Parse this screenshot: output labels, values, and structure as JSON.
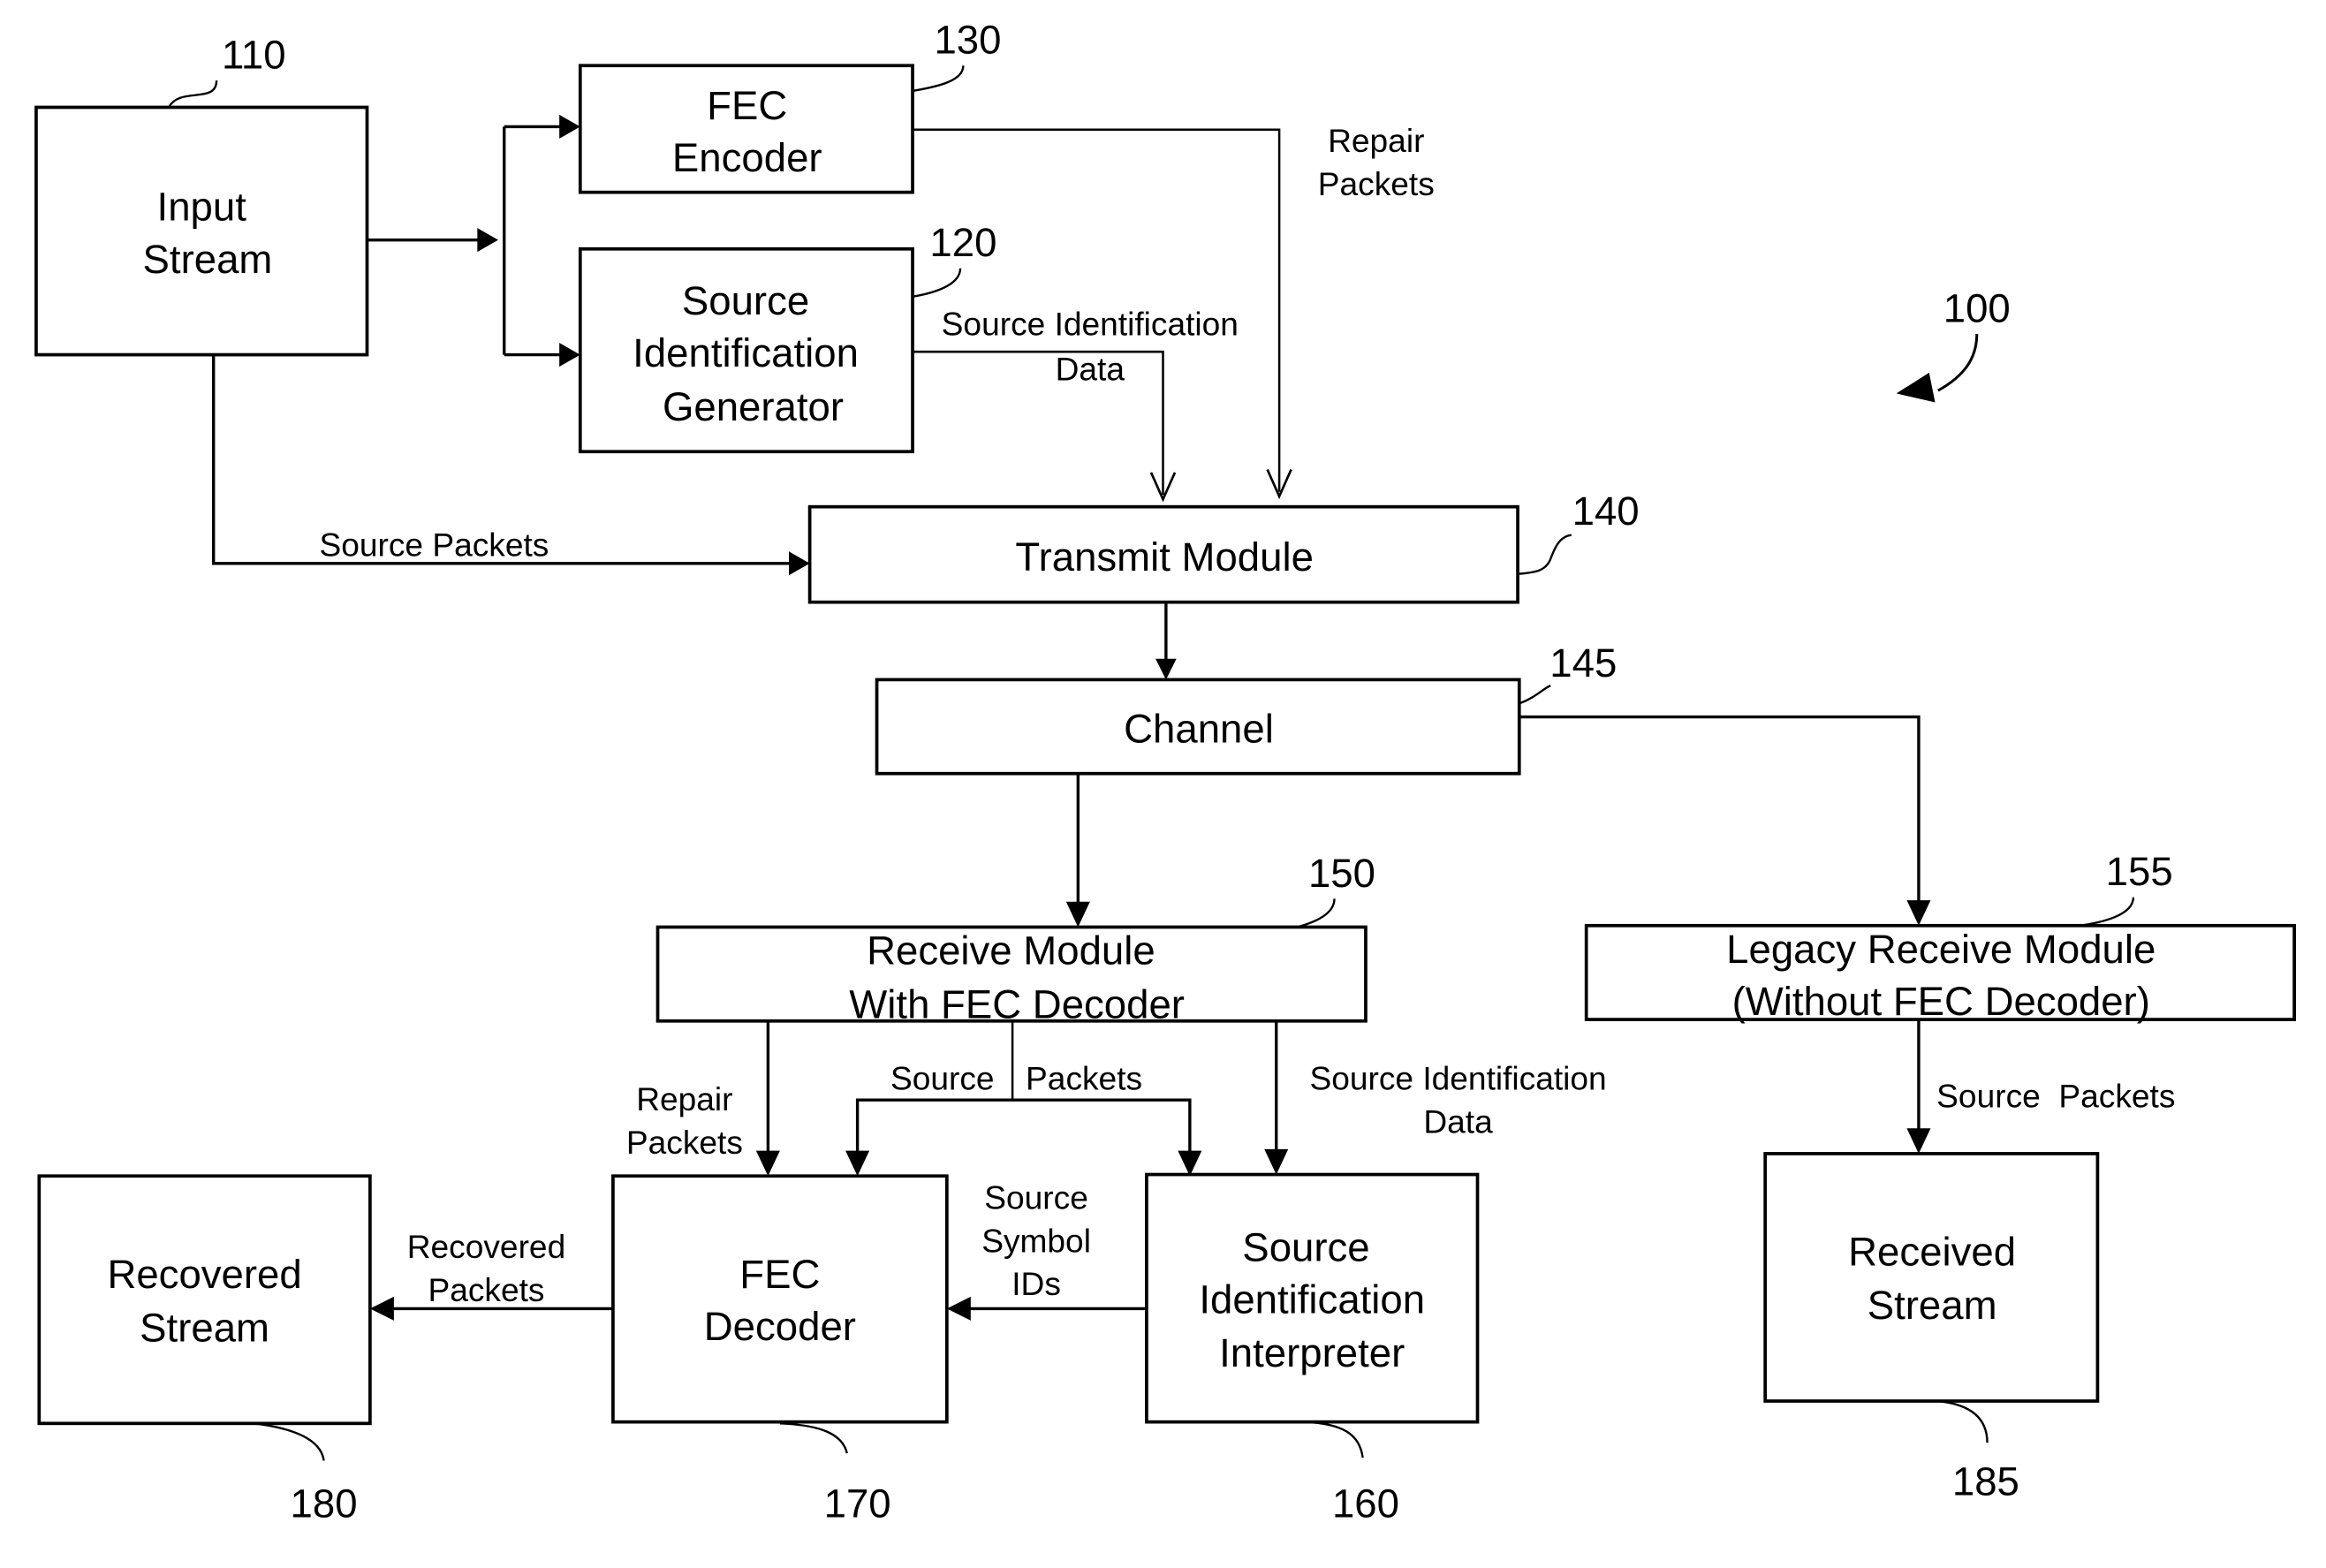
{
  "figure": {
    "reference": "100",
    "blocks": {
      "input_stream": {
        "ref": "110",
        "lines": [
          "Input",
          "Stream"
        ]
      },
      "fec_encoder": {
        "ref": "130",
        "lines": [
          "FEC",
          "Encoder"
        ]
      },
      "source_id_generator": {
        "ref": "120",
        "lines": [
          "Source",
          "Identification",
          "Generator"
        ]
      },
      "transmit_module": {
        "ref": "140",
        "lines": [
          "Transmit Module"
        ]
      },
      "channel": {
        "ref": "145",
        "lines": [
          "Channel"
        ]
      },
      "receive_module": {
        "ref": "150",
        "lines": [
          "Receive Module",
          "With FEC Decoder"
        ]
      },
      "legacy_receive_module": {
        "ref": "155",
        "lines": [
          "Legacy Receive Module",
          "(Without FEC Decoder)"
        ]
      },
      "source_id_interpreter": {
        "ref": "160",
        "lines": [
          "Source",
          "Identification",
          "Interpreter"
        ]
      },
      "fec_decoder": {
        "ref": "170",
        "lines": [
          "FEC",
          "Decoder"
        ]
      },
      "recovered_stream": {
        "ref": "180",
        "lines": [
          "Recovered",
          "Stream"
        ]
      },
      "received_stream": {
        "ref": "185",
        "lines": [
          "Received",
          "Stream"
        ]
      }
    },
    "flow_labels": {
      "repair_packets_tx": [
        "Repair",
        "Packets"
      ],
      "source_id_data_tx": [
        "Source Identification",
        "Data"
      ],
      "source_packets_tx": "Source Packets",
      "repair_packets_rx": [
        "Repair",
        "Packets"
      ],
      "source_packets_rx_left": "Source",
      "source_packets_rx_right": "Packets",
      "source_id_data_rx": [
        "Source Identification",
        "Data"
      ],
      "source_symbol_ids": [
        "Source",
        "Symbol",
        "IDs"
      ],
      "recovered_packets": [
        "Recovered",
        "Packets"
      ],
      "source_packets_legacy": "Source  Packets"
    }
  }
}
